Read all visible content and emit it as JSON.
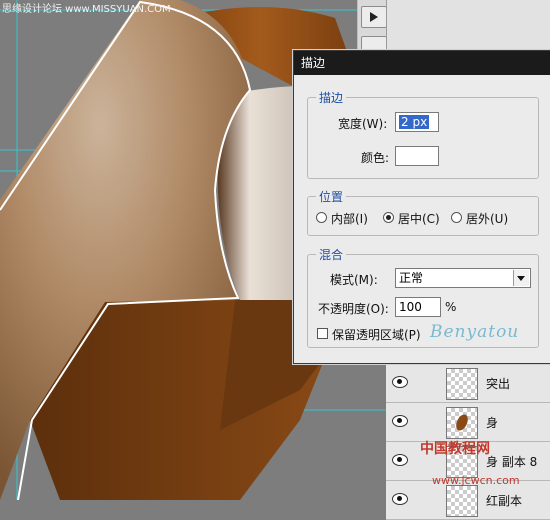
{
  "watermark_top": "思缘设计论坛 www.MISSYUAN.COM",
  "watermark_bottom": "中国教程网",
  "watermark_bottom_url": "www.jcwcn.com",
  "watermark_logo": "Benyatou",
  "dialog": {
    "title": "描边",
    "stroke_section": {
      "legend": "描边",
      "width_label": "宽度(W):",
      "width_value": "2 px",
      "color_label": "颜色:",
      "color_value": "#ffffff"
    },
    "position_section": {
      "legend": "位置",
      "options": [
        {
          "label": "内部(I)",
          "checked": false
        },
        {
          "label": "居中(C)",
          "checked": true
        },
        {
          "label": "居外(U)",
          "checked": false
        }
      ]
    },
    "blend_section": {
      "legend": "混合",
      "mode_label": "模式(M):",
      "mode_value": "正常",
      "opacity_label": "不透明度(O):",
      "opacity_value": "100",
      "opacity_unit": "%",
      "preserve_label": "保留透明区域(P)",
      "preserve_checked": false
    }
  },
  "layers": [
    {
      "name": "突出",
      "visible": true
    },
    {
      "name": "身",
      "visible": true
    },
    {
      "name": "身 副本 8",
      "visible": true
    },
    {
      "name": "红副本",
      "visible": true
    }
  ],
  "colors": {
    "wood": "#8a4a16",
    "dialog_title_bar": "#1b1b1b",
    "guide": "#33c6d1"
  }
}
